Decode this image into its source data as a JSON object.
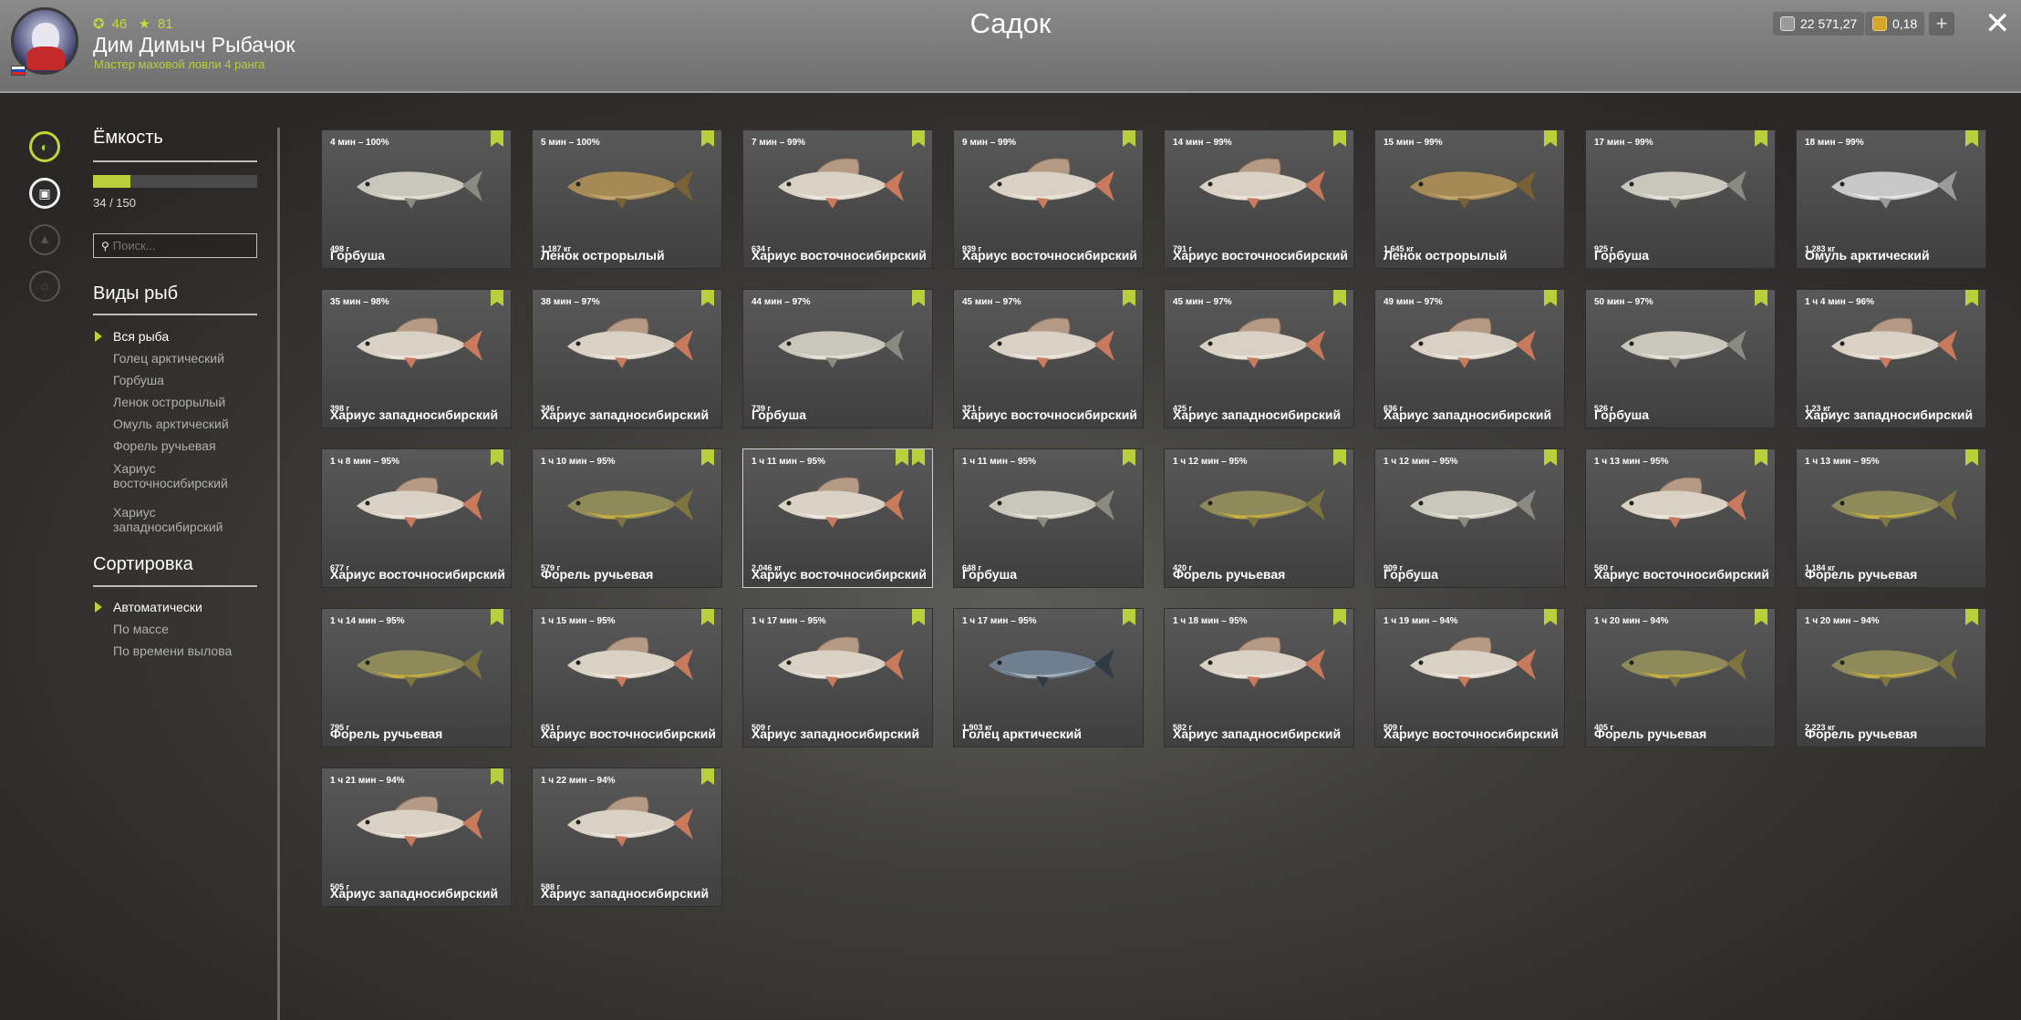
{
  "header": {
    "title": "Садок",
    "stat_coins": "46",
    "stat_stars": "81",
    "player_name": "Дим Димыч Рыбачок",
    "player_rank": "Мастер маховой ловли 4 ранга",
    "silver": "22 571,27",
    "gold": "0,18",
    "plus_label": "+",
    "close_label": "✕"
  },
  "capacity": {
    "title": "Ёмкость",
    "value": "34 / 150",
    "used": 34,
    "max": 150
  },
  "search": {
    "placeholder": "Поиск..."
  },
  "species": {
    "title": "Виды рыб",
    "items": [
      "Вся рыба",
      "Голец арктический",
      "Горбуша",
      "Ленок острорылый",
      "Омуль арктический",
      "Форель ручьевая",
      "Хариус восточносибирский",
      "Хариус западносибирский"
    ],
    "selected": "Вся рыба"
  },
  "sorting": {
    "title": "Сортировка",
    "items": [
      "Автоматически",
      "По массе",
      "По времени вылова"
    ],
    "selected": "Автоматически"
  },
  "colors": {
    "accent": "#b9cf3c",
    "grayling_body": "#d9d2c4",
    "grayling_fin": "#c97a5c",
    "salmon_body": "#c9c6bc",
    "lenok_body": "#a68a55",
    "trout_body": "#8f8a5a",
    "trout_belly": "#d6b838",
    "char_body": "#6f7f8f"
  },
  "fish": [
    {
      "time": "4 мин – 100%",
      "weight": "498 г",
      "name": "Горбуша",
      "kind": "salmon",
      "selected": false
    },
    {
      "time": "5 мин – 100%",
      "weight": "1,187 кг",
      "name": "Ленок острорылый",
      "kind": "lenok",
      "selected": false
    },
    {
      "time": "7 мин – 99%",
      "weight": "634 г",
      "name": "Хариус восточносибирский",
      "kind": "grayling_e",
      "selected": false
    },
    {
      "time": "9 мин – 99%",
      "weight": "939 г",
      "name": "Хариус восточносибирский",
      "kind": "grayling_e",
      "selected": false
    },
    {
      "time": "14 мин – 99%",
      "weight": "791 г",
      "name": "Хариус восточносибирский",
      "kind": "grayling_e",
      "selected": false
    },
    {
      "time": "15 мин – 99%",
      "weight": "1,645 кг",
      "name": "Ленок острорылый",
      "kind": "lenok",
      "selected": false
    },
    {
      "time": "17 мин – 99%",
      "weight": "925 г",
      "name": "Горбуша",
      "kind": "salmon",
      "selected": false
    },
    {
      "time": "18 мин – 99%",
      "weight": "1,283 кг",
      "name": "Омуль арктический",
      "kind": "omul",
      "selected": false
    },
    {
      "time": "35 мин – 98%",
      "weight": "398 г",
      "name": "Хариус западносибирский",
      "kind": "grayling_w",
      "selected": false
    },
    {
      "time": "38 мин – 97%",
      "weight": "346 г",
      "name": "Хариус западносибирский",
      "kind": "grayling_w",
      "selected": false
    },
    {
      "time": "44 мин – 97%",
      "weight": "739 г",
      "name": "Горбуша",
      "kind": "salmon",
      "selected": false
    },
    {
      "time": "45 мин – 97%",
      "weight": "321 г",
      "name": "Хариус восточносибирский",
      "kind": "grayling_e",
      "selected": false
    },
    {
      "time": "45 мин – 97%",
      "weight": "425 г",
      "name": "Хариус западносибирский",
      "kind": "grayling_w",
      "selected": false
    },
    {
      "time": "49 мин – 97%",
      "weight": "636 г",
      "name": "Хариус западносибирский",
      "kind": "grayling_w",
      "selected": false
    },
    {
      "time": "50 мин – 97%",
      "weight": "526 г",
      "name": "Горбуша",
      "kind": "salmon",
      "selected": false
    },
    {
      "time": "1 ч 4 мин – 96%",
      "weight": "1,23 кг",
      "name": "Хариус западносибирский",
      "kind": "grayling_w",
      "selected": false
    },
    {
      "time": "1 ч 8 мин – 95%",
      "weight": "677 г",
      "name": "Хариус восточносибирский",
      "kind": "grayling_e",
      "selected": false
    },
    {
      "time": "1 ч 10 мин – 95%",
      "weight": "579 г",
      "name": "Форель ручьевая",
      "kind": "trout",
      "selected": false
    },
    {
      "time": "1 ч 11 мин – 95%",
      "weight": "2,046 кг",
      "name": "Хариус восточносибирский",
      "kind": "grayling_e",
      "selected": true
    },
    {
      "time": "1 ч 11 мин – 95%",
      "weight": "648 г",
      "name": "Горбуша",
      "kind": "salmon",
      "selected": false
    },
    {
      "time": "1 ч 12 мин – 95%",
      "weight": "420 г",
      "name": "Форель ручьевая",
      "kind": "trout",
      "selected": false
    },
    {
      "time": "1 ч 12 мин – 95%",
      "weight": "909 г",
      "name": "Горбуша",
      "kind": "salmon",
      "selected": false
    },
    {
      "time": "1 ч 13 мин – 95%",
      "weight": "560 г",
      "name": "Хариус восточносибирский",
      "kind": "grayling_e",
      "selected": false
    },
    {
      "time": "1 ч 13 мин – 95%",
      "weight": "1,184 кг",
      "name": "Форель ручьевая",
      "kind": "trout",
      "selected": false
    },
    {
      "time": "1 ч 14 мин – 95%",
      "weight": "795 г",
      "name": "Форель ручьевая",
      "kind": "trout",
      "selected": false
    },
    {
      "time": "1 ч 15 мин – 95%",
      "weight": "651 г",
      "name": "Хариус восточносибирский",
      "kind": "grayling_e",
      "selected": false
    },
    {
      "time": "1 ч 17 мин – 95%",
      "weight": "509 г",
      "name": "Хариус западносибирский",
      "kind": "grayling_w",
      "selected": false
    },
    {
      "time": "1 ч 17 мин – 95%",
      "weight": "1,903 кг",
      "name": "Голец арктический",
      "kind": "char",
      "selected": false
    },
    {
      "time": "1 ч 18 мин – 95%",
      "weight": "582 г",
      "name": "Хариус западносибирский",
      "kind": "grayling_w",
      "selected": false
    },
    {
      "time": "1 ч 19 мин – 94%",
      "weight": "509 г",
      "name": "Хариус восточносибирский",
      "kind": "grayling_e",
      "selected": false
    },
    {
      "time": "1 ч 20 мин – 94%",
      "weight": "405 г",
      "name": "Форель ручьевая",
      "kind": "trout",
      "selected": false
    },
    {
      "time": "1 ч 20 мин – 94%",
      "weight": "2,223 кг",
      "name": "Форель ручьевая",
      "kind": "trout",
      "selected": false
    },
    {
      "time": "1 ч 21 мин – 94%",
      "weight": "505 г",
      "name": "Хариус западносибирский",
      "kind": "grayling_w",
      "selected": false
    },
    {
      "time": "1 ч 22 мин – 94%",
      "weight": "588 г",
      "name": "Хариус западносибирский",
      "kind": "grayling_w",
      "selected": false
    }
  ]
}
